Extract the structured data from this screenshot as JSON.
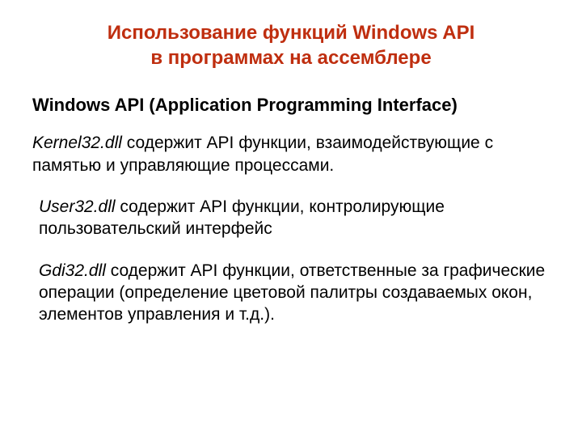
{
  "title": {
    "line1": "Использование функций Windows API",
    "line2": "в программах на ассемблере"
  },
  "subtitle": "Windows API (Application Programming Interface)",
  "paragraphs": [
    {
      "dll": "Kernel32.dll",
      "text": "  содержит API функции, взаимодействующие с памятью и управляющие процессами."
    },
    {
      "dll": "User32.dll",
      "text": "  содержит API функции, контролирующие пользовательский интерфейс"
    },
    {
      "dll": "Gdi32.dll",
      "text": "  содержит API функции, ответственные за графические операции (определение цветовой палитры создаваемых окон, элементов управления и т.д.)."
    }
  ]
}
